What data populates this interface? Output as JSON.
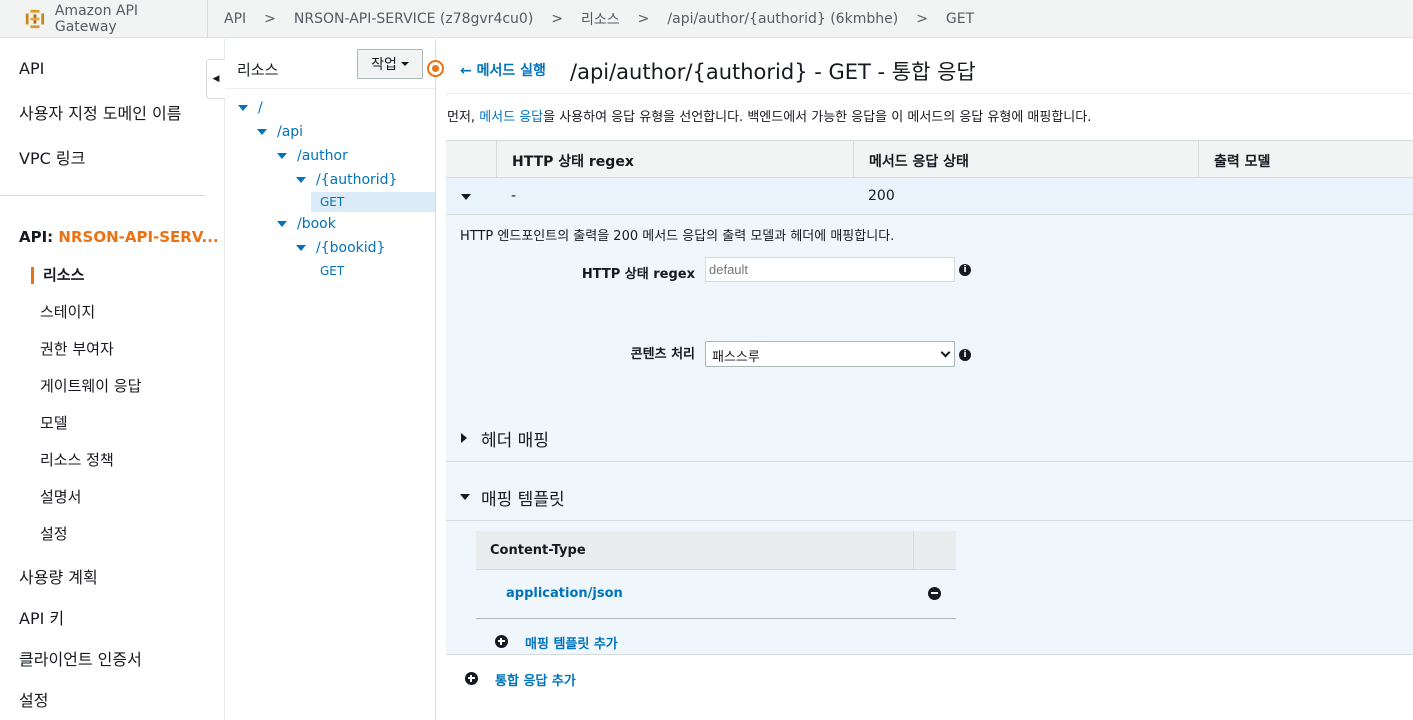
{
  "topbar": {
    "brand": "Amazon API Gateway",
    "breadcrumbs": [
      "API",
      "NRSON-API-SERVICE (z78gvr4cu0)",
      "리소스",
      "/api/author/{authorid} (6kmbhe)",
      "GET"
    ],
    "separator": ">"
  },
  "sidebar": {
    "top_items": [
      "API",
      "사용자 지정 도메인 이름",
      "VPC 링크"
    ],
    "api_prefix": "API: ",
    "api_name": "NRSON-API-SERV...",
    "api_items": [
      "리소스",
      "스테이지",
      "권한 부여자",
      "게이트웨이 응답",
      "모델",
      "리소스 정책",
      "설명서",
      "설정"
    ],
    "bottom_items": [
      "사용량 계획",
      "API 키",
      "클라이언트 인증서",
      "설정"
    ]
  },
  "tree": {
    "title": "리소스",
    "action_button": "작업",
    "nodes": [
      "/",
      "/api",
      "/author",
      "/{authorid}",
      "GET",
      "/book",
      "/{bookid}",
      "GET"
    ]
  },
  "main": {
    "back_label": "메서드 실행",
    "title": "/api/author/{authorid} - GET - 통합 응답",
    "intro_before": "먼저, ",
    "intro_link": "메서드 응답",
    "intro_after": "을 사용하여 응답 유형을 선언합니다. 백엔드에서 가능한 응답을 이 메서드의 응답 유형에 매핑합니다.",
    "table": {
      "headers": [
        "HTTP 상태 regex",
        "메서드 응답 상태",
        "출력 모델"
      ],
      "row": {
        "regex": "-",
        "status": "200",
        "model": ""
      }
    },
    "detail": {
      "description": "HTTP 엔드포인트의 출력을 200 메서드 응답의 출력 모델과 헤더에 매핑합니다.",
      "regex_label": "HTTP 상태 regex",
      "regex_placeholder": "default",
      "content_label": "콘텐츠 처리",
      "content_value": "패스스루",
      "header_mapping": "헤더 매핑",
      "mapping_templates": "매핑 템플릿",
      "ct_header": "Content-Type",
      "ct_value": "application/json",
      "add_template": "매핑 템플릿 추가"
    },
    "add_integration_response": "통합 응답 추가"
  },
  "colors": {
    "accent": "#ec7211",
    "link": "#0073bb"
  }
}
